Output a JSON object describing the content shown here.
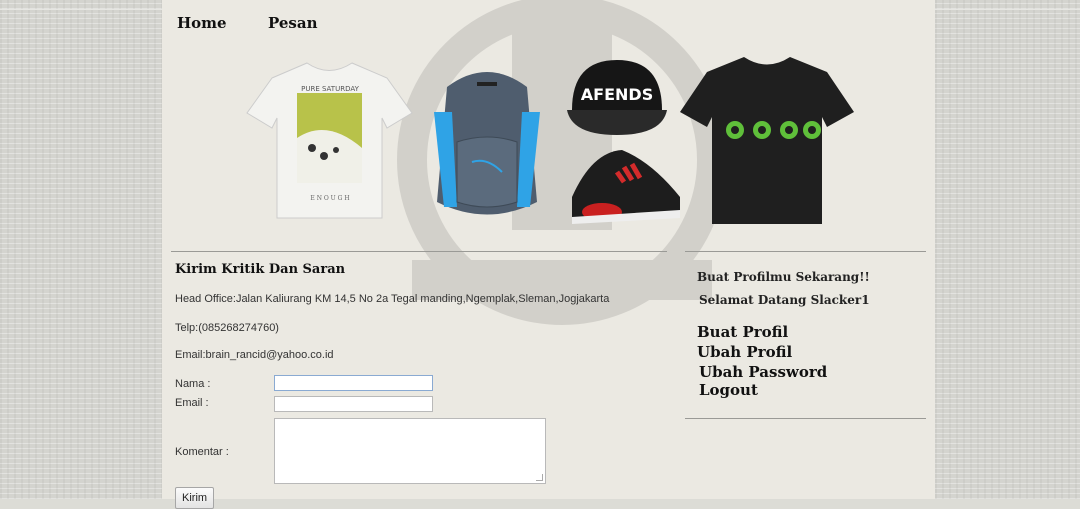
{
  "nav": {
    "home": "Home",
    "pesan": "Pesan"
  },
  "banner": {
    "tshirt_white_title": "PURE SATURDAY",
    "tshirt_white_bottom": "E N O U G H",
    "cap_text": "AFENDS"
  },
  "contact": {
    "heading": "Kirim Kritik Dan Saran",
    "office": "Head Office:Jalan Kaliurang KM 14,5 No 2a Tegal manding,Ngemplak,Sleman,Jogjakarta",
    "phone": "Telp:(085268274760)",
    "email": "Email:brain_rancid@yahoo.co.id"
  },
  "form": {
    "nama_label": "Nama :",
    "email_label": "Email :",
    "komentar_label": "Komentar :",
    "nama_value": "",
    "email_value": "",
    "komentar_value": "",
    "submit": "Kirim"
  },
  "sidebar": {
    "cta": "Buat Profilmu Sekarang!!",
    "welcome": "Selamat Datang Slacker1",
    "links": [
      "Buat Profil",
      "Ubah Profil",
      "Ubah Password",
      "Logout"
    ]
  },
  "colors": {
    "page_bg": "#ebe9e2",
    "side_bg": "#d4d4cf",
    "text": "#111111"
  }
}
